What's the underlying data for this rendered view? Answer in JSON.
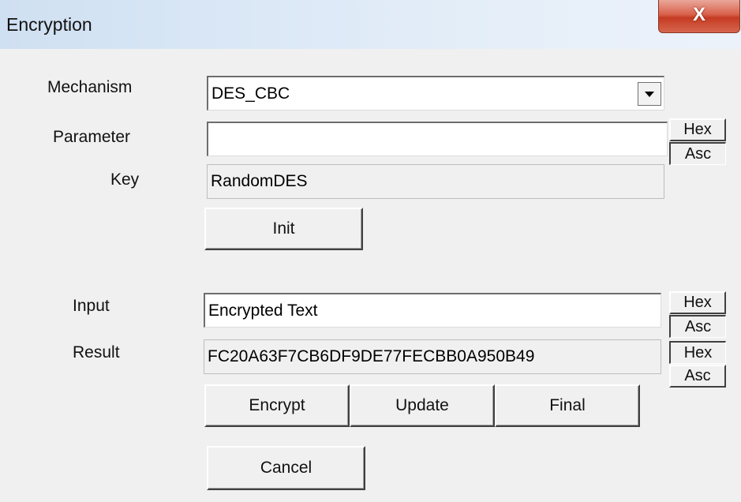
{
  "window": {
    "title": "Encryption",
    "close_label": "X"
  },
  "mechanism": {
    "label": "Mechanism",
    "value": "DES_CBC"
  },
  "parameter": {
    "label": "Parameter",
    "value": "",
    "hex": "Hex",
    "asc": "Asc"
  },
  "key": {
    "label": "Key",
    "value": "RandomDES"
  },
  "init_label": "Init",
  "input": {
    "label": "Input",
    "value": "Encrypted Text",
    "hex": "Hex",
    "asc": "Asc"
  },
  "result": {
    "label": "Result",
    "value": "FC20A63F7CB6DF9DE77FECBB0A950B49",
    "hex": "Hex",
    "asc": "Asc"
  },
  "actions": {
    "encrypt": "Encrypt",
    "update": "Update",
    "final": "Final"
  },
  "cancel_label": "Cancel"
}
